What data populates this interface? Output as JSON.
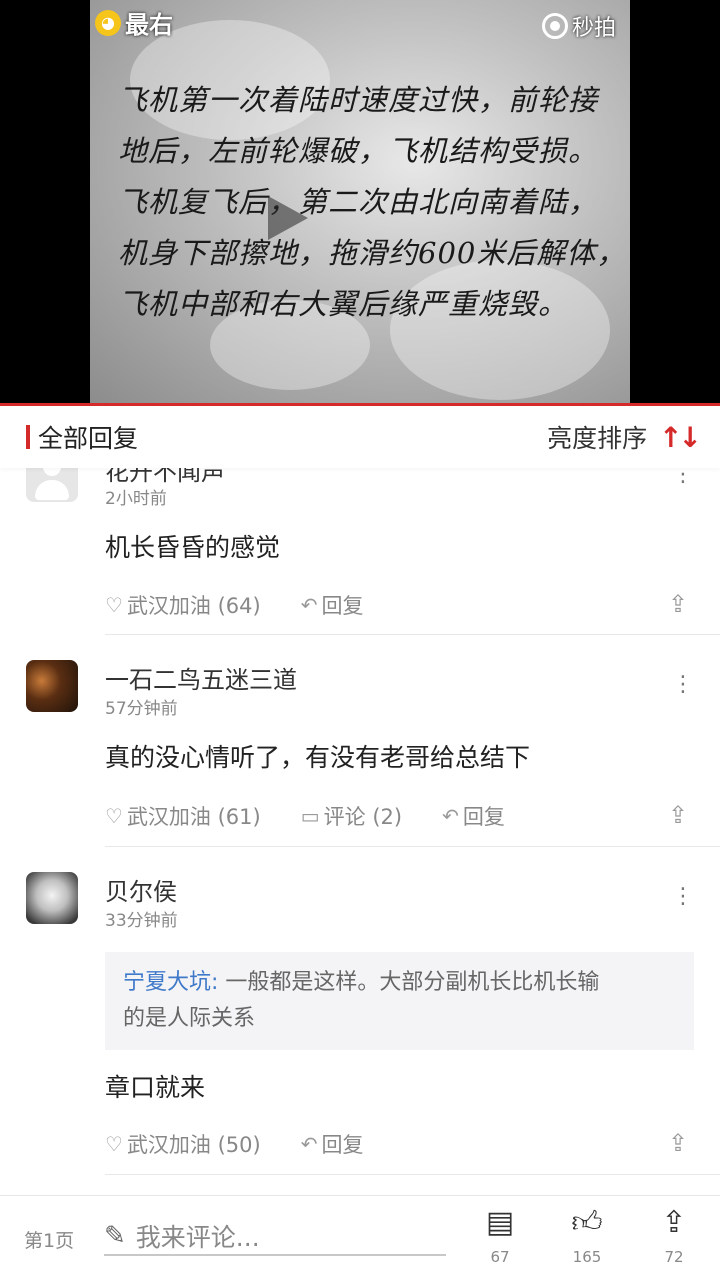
{
  "video": {
    "logo_left": "最右",
    "logo_right": "秒拍",
    "subtitle_lines": [
      "飞机第一次着陆时速度过快，前轮接",
      "地后，左前轮爆破，飞机结构受损。",
      "飞机复飞后，第二次由北向南着陆，",
      "机身下部擦地，拖滑约600米后解体，",
      "飞机中部和右大翼后缘严重烧毁。"
    ]
  },
  "reply_header": {
    "title": "全部回复",
    "sort_label": "亮度排序",
    "sort_icon": "sort-arrows-icon"
  },
  "comments": [
    {
      "username": "花开不闻声",
      "time": "2小时前",
      "content": "机长昏昏的感觉",
      "like_label": "武汉加油 (64)",
      "reply_label": "回复"
    },
    {
      "username": "一石二鸟五迷三道",
      "time": "57分钟前",
      "content": "真的没心情听了，有没有老哥给总结下",
      "like_label": "武汉加油 (61)",
      "comment_label": "评论 (2)",
      "reply_label": "回复"
    },
    {
      "username": "贝尔侯",
      "time": "33分钟前",
      "quote_name": "宁夏大坑:",
      "quote_line1": " 一般都是这样。大部分副机长比机长输",
      "quote_line2": "的是人际关系",
      "content": "章口就来",
      "like_label": "武汉加油 (50)",
      "reply_label": "回复"
    }
  ],
  "bottom_bar": {
    "page": "第1页",
    "input_placeholder": "我来评论...",
    "comments_count": "67",
    "likes_count": "165",
    "shares_count": "72"
  },
  "colors": {
    "accent": "#d52a2a",
    "link": "#3f79c9"
  }
}
